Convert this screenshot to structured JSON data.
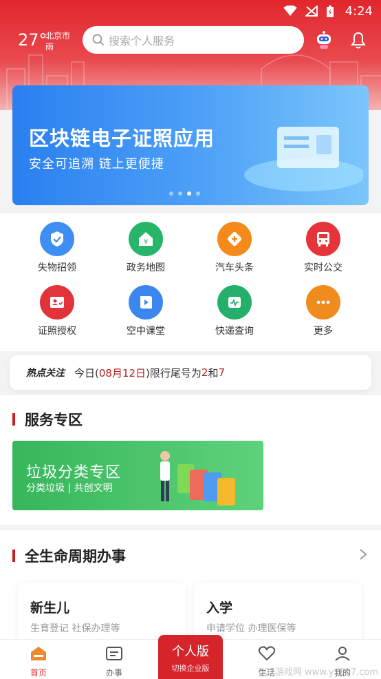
{
  "status": {
    "time": "4:24"
  },
  "weather": {
    "temp": "27°",
    "city": "北京市",
    "condition": "雨"
  },
  "search": {
    "placeholder": "搜索个人服务"
  },
  "banner": {
    "title": "区块链电子证照应用",
    "subtitle": "安全可追溯 链上更便捷",
    "active_dot": 3,
    "dot_count": 4
  },
  "services": [
    {
      "label": "失物招领",
      "icon": "shield-check-icon",
      "color": "#3f8ef2"
    },
    {
      "label": "政务地图",
      "icon": "yuan-house-icon",
      "color": "#27b56a"
    },
    {
      "label": "汽车头条",
      "icon": "road-sign-plus-icon",
      "color": "#f48a1c"
    },
    {
      "label": "实时公交",
      "icon": "bus-icon",
      "color": "#e5343a"
    },
    {
      "label": "证照授权",
      "icon": "id-card-icon",
      "color": "#e0343a"
    },
    {
      "label": "空中课堂",
      "icon": "play-book-icon",
      "color": "#3c86ef"
    },
    {
      "label": "快递查询",
      "icon": "tracking-icon",
      "color": "#24b06a"
    },
    {
      "label": "更多",
      "icon": "more-dots-icon",
      "color": "#f08b1d"
    }
  ],
  "hot": {
    "tag": "热点关注",
    "text_pre": "今日(",
    "date": "08月12日",
    "text_mid": ")限行尾号为",
    "num1": "2",
    "and": "和",
    "num2": "7"
  },
  "service_zone": {
    "title": "服务专区",
    "garbage_title": "垃圾分类专区",
    "garbage_sub": "分类垃圾 | 共创文明"
  },
  "lifecycle": {
    "title": "全生命周期办事",
    "cards": [
      {
        "title": "新生儿",
        "subtitle": "生育登记 社保办理等"
      },
      {
        "title": "入学",
        "subtitle": "申请学位 办理医保等"
      }
    ]
  },
  "tabbar": {
    "home": "首页",
    "tasks": "办事",
    "personal_title": "个人版",
    "personal_sub": "切换企业版",
    "life": "生活",
    "mine": "我的"
  },
  "watermark": "007游戏网 www.yx007.com",
  "colors": {
    "brand_red": "#d5252b",
    "accent_red": "#c71f25"
  }
}
